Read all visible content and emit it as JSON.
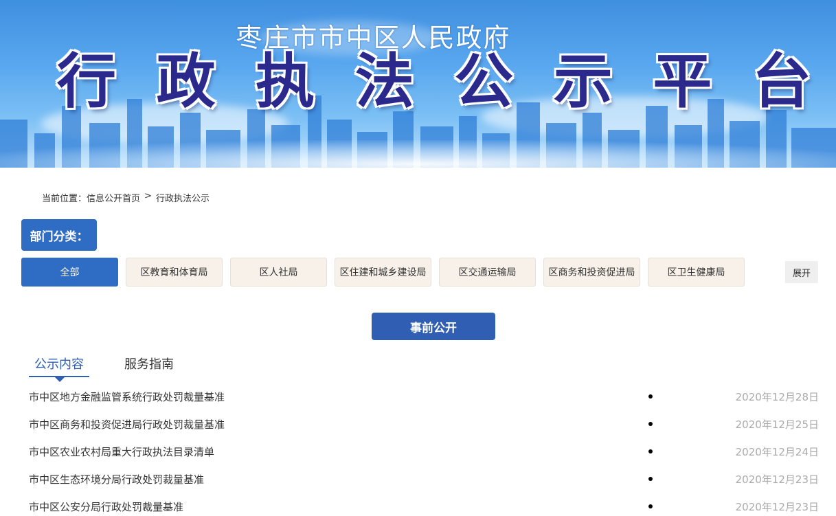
{
  "banner": {
    "subtitle": "枣庄市市中区人民政府",
    "title_chars": [
      "行",
      "政",
      "执",
      "法",
      "公",
      "示",
      "平",
      "台"
    ]
  },
  "breadcrumb": {
    "prefix": "当前位置：",
    "home": "信息公开首页",
    "separator": ">",
    "current": "行政执法公示"
  },
  "departments": {
    "label": "部门分类：",
    "items": [
      "全部",
      "区教育和体育局",
      "区人社局",
      "区住建和城乡建设局",
      "区交通运输局",
      "区商务和投资促进局",
      "区卫生健康局"
    ],
    "active_index": 0,
    "expand_label": "展开"
  },
  "section": {
    "button_label": "事前公开"
  },
  "tabs": [
    {
      "label": "公示内容",
      "active": true
    },
    {
      "label": "服务指南",
      "active": false
    }
  ],
  "list": [
    {
      "title": "市中区地方金融监管系统行政处罚裁量基准",
      "date": "2020年12月28日"
    },
    {
      "title": "市中区商务和投资促进局行政处罚裁量基准",
      "date": "2020年12月25日"
    },
    {
      "title": "市中区农业农村局重大行政执法目录清单",
      "date": "2020年12月24日"
    },
    {
      "title": "市中区生态环境分局行政处罚裁量基准",
      "date": "2020年12月23日"
    },
    {
      "title": "市中区公安分局行政处罚裁量基准",
      "date": "2020年12月23日"
    }
  ],
  "colors": {
    "accent": "#2f6cc4",
    "section_button": "#2f5eb2",
    "dept_button_bg": "#f8f1ea",
    "title_text": "#2b2a8c"
  }
}
